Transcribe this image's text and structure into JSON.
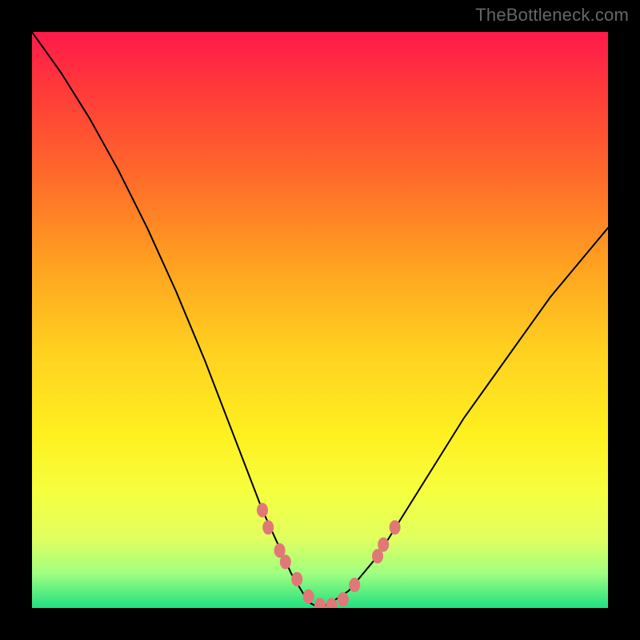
{
  "watermark": "TheBottleneck.com",
  "chart_data": {
    "type": "line",
    "title": "",
    "xlabel": "",
    "ylabel": "",
    "xlim": [
      0,
      100
    ],
    "ylim": [
      0,
      100
    ],
    "grid": false,
    "legend": false,
    "note": "V-shaped bottleneck curve over a vertical heat gradient (red=high bottleneck at top, green=low at bottom). The curve minimum (~0) sits around x≈50. A cluster of salmon-coloured dots lies on the curve near the trough, roughly x 40–63.",
    "series": [
      {
        "name": "bottleneck-curve",
        "x": [
          0,
          5,
          10,
          15,
          20,
          25,
          30,
          35,
          40,
          45,
          48,
          50,
          52,
          55,
          60,
          65,
          70,
          75,
          80,
          85,
          90,
          95,
          100
        ],
        "values": [
          100,
          93,
          85,
          76,
          66,
          55,
          43,
          30,
          17,
          6,
          1,
          0,
          1,
          3,
          9,
          17,
          25,
          33,
          40,
          47,
          54,
          60,
          66
        ]
      }
    ],
    "dots": {
      "name": "highlight-dots",
      "color": "#e07878",
      "points": [
        {
          "x": 40,
          "y": 17
        },
        {
          "x": 41,
          "y": 14
        },
        {
          "x": 43,
          "y": 10
        },
        {
          "x": 44,
          "y": 8
        },
        {
          "x": 46,
          "y": 5
        },
        {
          "x": 48,
          "y": 2
        },
        {
          "x": 50,
          "y": 0.5
        },
        {
          "x": 52,
          "y": 0.5
        },
        {
          "x": 54,
          "y": 1.5
        },
        {
          "x": 56,
          "y": 4
        },
        {
          "x": 60,
          "y": 9
        },
        {
          "x": 61,
          "y": 11
        },
        {
          "x": 63,
          "y": 14
        }
      ]
    }
  }
}
